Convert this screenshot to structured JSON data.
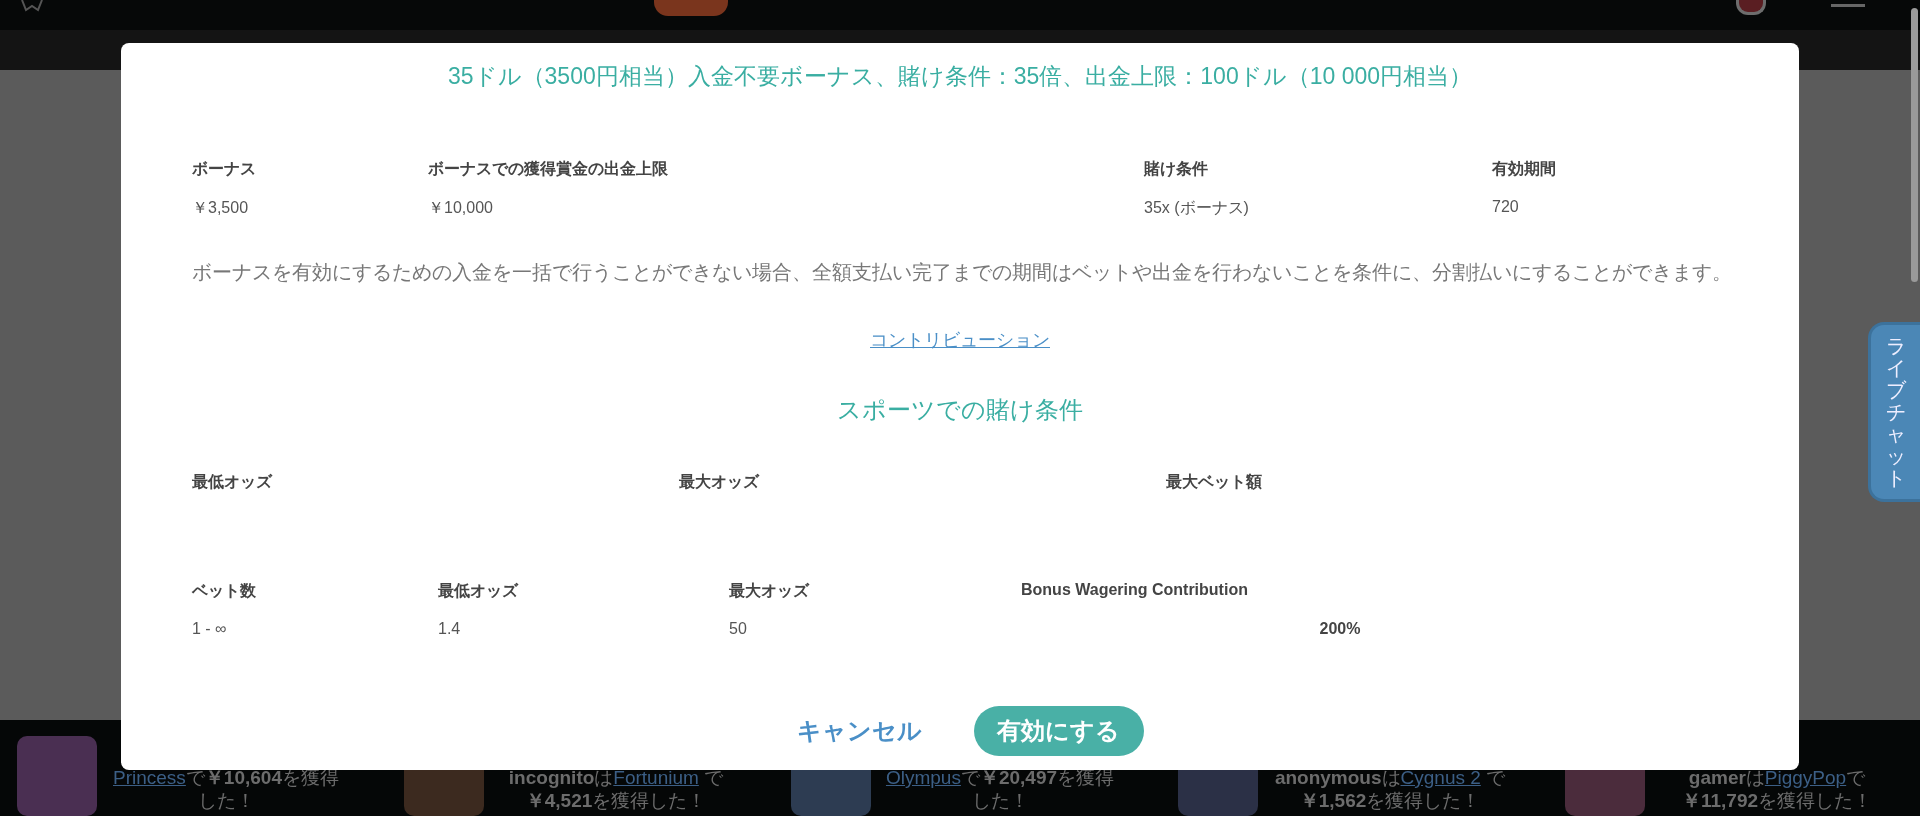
{
  "modal": {
    "title": "35ドル（3500円相当）入金不要ボーナス、賭け条件：35倍、出金上限：100ドル（10 000円相当）",
    "bonus_table": {
      "columns": [
        "ボーナス",
        "ボーナスでの獲得賞金の出金上限",
        "賭け条件",
        "有効期間"
      ],
      "values": [
        "￥3,500",
        "￥10,000",
        "35x (ボーナス)",
        "720"
      ]
    },
    "note": "ボーナスを有効にするための入金を一括で行うことができない場合、全額支払い完了までの期間はベットや出金を行わないことを条件に、分割払いにすることができます。",
    "link": "コントリビューション",
    "sports_heading": "スポーツでの賭け条件",
    "odds_table": {
      "columns": [
        "最低オッズ",
        "最大オッズ",
        "最大ベット額"
      ]
    },
    "contribution_table": {
      "columns": [
        "ベット数",
        "最低オッズ",
        "最大オッズ",
        "Bonus Wagering Contribution"
      ],
      "values": [
        "1 - ∞",
        "1.4",
        "50",
        "200%"
      ]
    },
    "buttons": [
      {
        "label": "キャンセル",
        "kind": "text"
      },
      {
        "label": "有効にする",
        "kind": "primary"
      }
    ]
  },
  "live_chat": {
    "label": "ライブチャット"
  },
  "ticker": [
    {
      "game": "Princess",
      "suffix": "で",
      "amount": "￥10,604",
      "result": "を獲得した！"
    },
    {
      "user": "incognito",
      "connector": "は",
      "game": "Fortunium",
      "suffix": " で",
      "amount": "￥4,521",
      "result": "を獲得した！"
    },
    {
      "game": "Olympus",
      "suffix": "で",
      "amount": "￥20,497",
      "result": "を獲得した！"
    },
    {
      "user": "anonymous",
      "connector": "は",
      "game": "Cygnus 2",
      "suffix": " で",
      "amount": "￥1,562",
      "result": "を獲得した！"
    },
    {
      "user": "gamer",
      "connector": "は",
      "game": "PiggyPop",
      "suffix": "で",
      "amount": "￥11,792",
      "result": "を獲得した！"
    }
  ]
}
